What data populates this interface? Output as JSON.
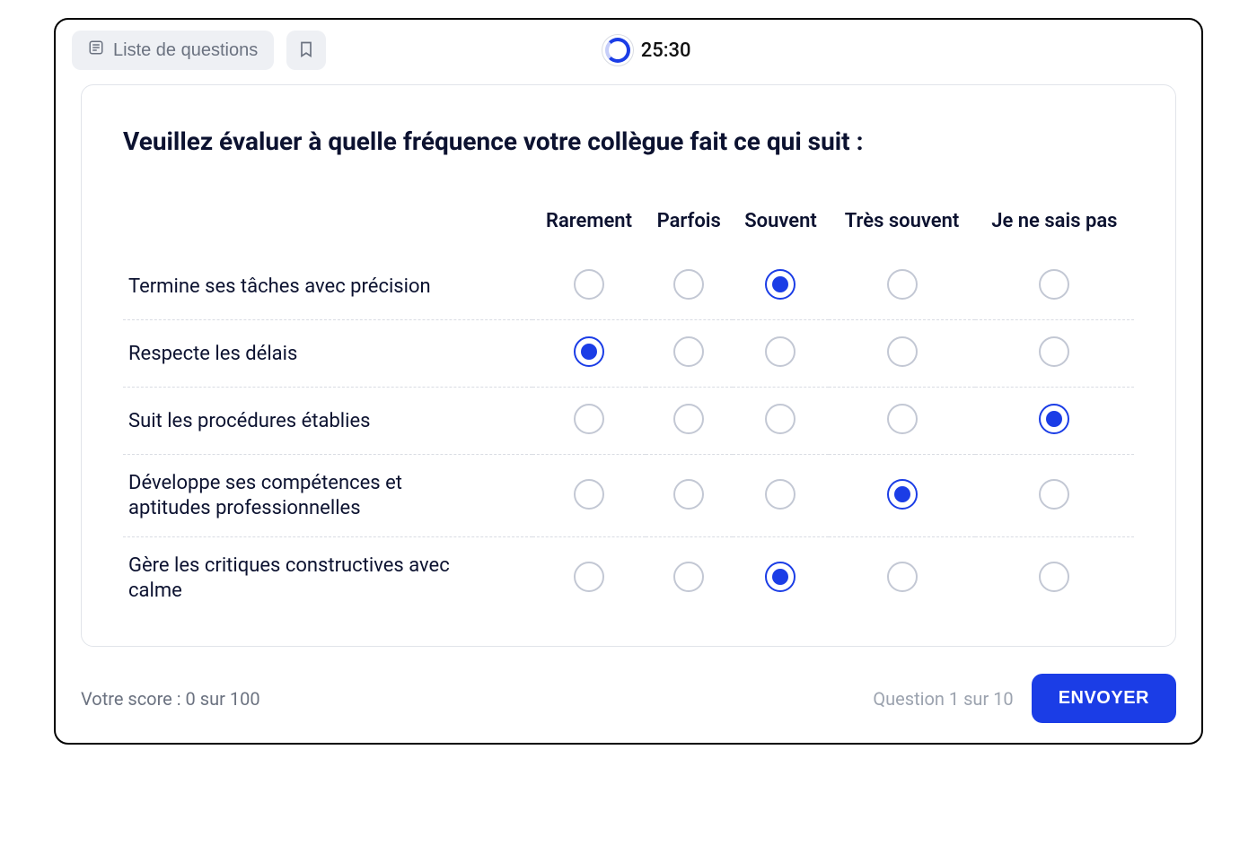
{
  "topbar": {
    "question_list_label": "Liste de questions",
    "timer": "25:30"
  },
  "question": {
    "title": "Veuillez évaluer à quelle fréquence votre collègue fait ce qui suit :",
    "columns": [
      "Rarement",
      "Parfois",
      "Souvent",
      "Très souvent",
      "Je ne sais pas"
    ],
    "rows": [
      {
        "label": "Termine ses tâches avec précision",
        "selected": 2
      },
      {
        "label": "Respecte les délais",
        "selected": 0
      },
      {
        "label": "Suit les procédures établies",
        "selected": 4
      },
      {
        "label": "Développe ses compétences et aptitudes professionnelles",
        "selected": 3
      },
      {
        "label": "Gère les critiques constructives avec calme",
        "selected": 2
      }
    ]
  },
  "footer": {
    "score": "Votre score : 0 sur 100",
    "progress": "Question 1 sur 10",
    "submit": "ENVOYER"
  }
}
